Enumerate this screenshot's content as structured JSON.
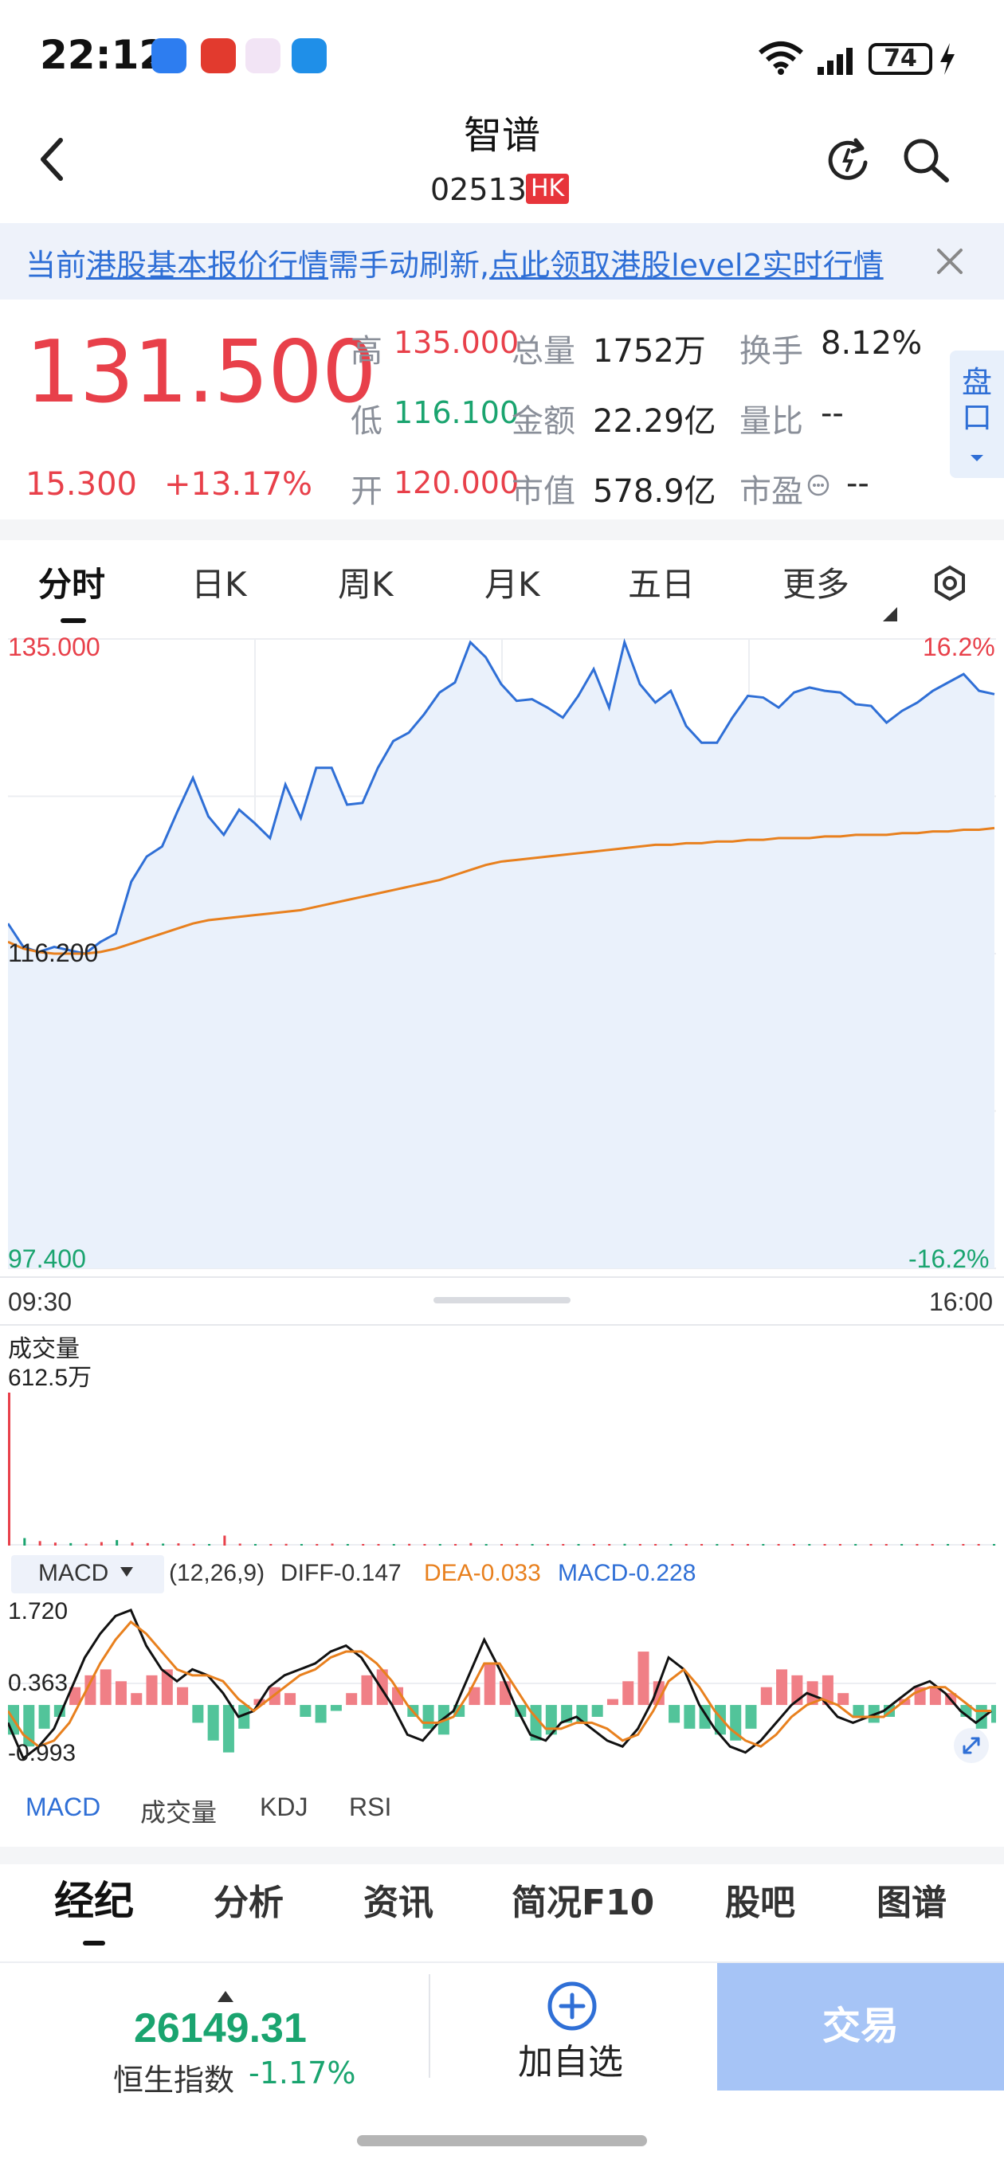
{
  "status_bar": {
    "time": "22:12",
    "battery": "74"
  },
  "header": {
    "title": "智谱",
    "code": "02513",
    "market_badge": "HK"
  },
  "banner": {
    "text_a": "当前港股基本报价行情需手动刷新,",
    "text_link": "点此领取港股level2实时行情",
    "text_a_prefix": "当前",
    "text_a_u": "港股基本报价行情",
    "text_a_suffix": "需手动刷新,"
  },
  "quote": {
    "price": "131.500",
    "change": "15.300",
    "change_pct": "+13.17%",
    "rows": [
      {
        "l1": "高",
        "v1": "135.000",
        "l2": "总量",
        "v2": "1752万",
        "l3": "换手",
        "v3": "8.12%"
      },
      {
        "l1": "低",
        "v1": "116.100",
        "l2": "金额",
        "v2": "22.29亿",
        "l3": "量比",
        "v3": "--"
      },
      {
        "l1": "开",
        "v1": "120.000",
        "l2": "市值",
        "v2": "578.9亿",
        "l3": "市盈",
        "v3": "--"
      }
    ],
    "pankou_label": "盘口"
  },
  "period_tabs": [
    "分时",
    "日K",
    "周K",
    "月K",
    "五日",
    "更多"
  ],
  "chart_data": [
    {
      "type": "line",
      "title": "",
      "ylim": [
        97.4,
        135.0
      ],
      "y_labels": {
        "top": "135.000",
        "mid": "116.200",
        "bottom": "97.400",
        "pct_top": "16.2%",
        "pct_bottom": "-16.2%"
      },
      "x_labels": {
        "start": "09:30",
        "end": "16:00"
      },
      "series": [
        {
          "color": "#2f6fd6",
          "values": [
            118.0,
            116.6,
            116.3,
            116.6,
            116.4,
            116.2,
            116.9,
            117.4,
            120.5,
            122.0,
            122.6,
            124.7,
            126.7,
            124.4,
            123.3,
            124.8,
            124.0,
            123.1,
            126.3,
            124.3,
            127.3,
            127.3,
            125.1,
            125.2,
            127.3,
            128.9,
            129.4,
            130.5,
            131.8,
            132.4,
            134.8,
            133.9,
            132.3,
            131.3,
            131.4,
            130.9,
            130.3,
            131.6,
            133.2,
            130.9,
            134.8,
            132.3,
            131.2,
            131.9,
            129.8,
            128.8,
            128.8,
            130.3,
            131.6,
            131.5,
            130.9,
            131.8,
            132.1,
            131.9,
            131.8,
            131.1,
            131.0,
            130.0,
            130.7,
            131.2,
            131.9,
            132.4,
            132.9,
            131.9,
            131.7
          ]
        },
        {
          "color": "#e8801e",
          "values": [
            116.9,
            116.5,
            116.3,
            116.2,
            116.2,
            116.2,
            116.3,
            116.5,
            116.8,
            117.1,
            117.4,
            117.7,
            118.0,
            118.2,
            118.3,
            118.4,
            118.5,
            118.6,
            118.7,
            118.8,
            119.0,
            119.2,
            119.4,
            119.6,
            119.8,
            120.0,
            120.2,
            120.4,
            120.6,
            120.9,
            121.2,
            121.5,
            121.7,
            121.8,
            121.9,
            122.0,
            122.1,
            122.2,
            122.3,
            122.4,
            122.5,
            122.6,
            122.7,
            122.7,
            122.8,
            122.8,
            122.9,
            122.9,
            123.0,
            123.0,
            123.1,
            123.1,
            123.1,
            123.2,
            123.2,
            123.3,
            123.3,
            123.3,
            123.4,
            123.4,
            123.5,
            123.5,
            123.6,
            123.6,
            123.7
          ]
        }
      ]
    },
    {
      "type": "bar",
      "title": "成交量",
      "max_label": "612.5万",
      "ylim": [
        0,
        612.5
      ],
      "values": [
        612.5,
        30,
        18,
        12,
        10,
        8,
        14,
        22,
        12,
        10,
        8,
        9,
        7,
        6,
        40,
        8,
        6,
        5,
        7,
        6,
        5,
        8,
        6,
        5,
        4,
        6,
        7,
        5,
        4,
        6,
        10,
        5,
        4,
        5,
        6,
        4,
        5,
        4,
        6,
        5,
        7,
        4,
        5,
        4,
        3,
        5,
        4,
        3,
        5,
        4,
        6,
        3,
        4,
        5,
        3,
        4,
        3,
        5,
        4,
        3,
        4,
        3,
        4,
        5,
        3
      ]
    },
    {
      "type": "bar",
      "title": "MACD",
      "params": "(12,26,9)",
      "diff_label": "DIFF-0.147",
      "dea_label": "DEA-0.033",
      "macd_label": "MACD-0.228",
      "y_labels": {
        "top": "1.720",
        "mid": "0.363",
        "bottom": "-0.993"
      },
      "ylim": [
        -0.993,
        1.72
      ],
      "macd": [
        -0.5,
        -0.7,
        -0.4,
        -0.2,
        0.3,
        0.5,
        0.6,
        0.4,
        0.2,
        0.5,
        0.6,
        0.3,
        -0.3,
        -0.6,
        -0.8,
        -0.4,
        0.1,
        0.3,
        0.2,
        -0.2,
        -0.3,
        -0.1,
        0.2,
        0.5,
        0.6,
        0.3,
        -0.2,
        -0.4,
        -0.5,
        -0.2,
        0.3,
        0.7,
        0.4,
        -0.2,
        -0.6,
        -0.5,
        -0.3,
        -0.3,
        -0.2,
        0.1,
        0.4,
        0.9,
        0.4,
        -0.3,
        -0.4,
        -0.4,
        -0.5,
        -0.6,
        -0.4,
        0.3,
        0.6,
        0.5,
        0.4,
        0.5,
        0.2,
        -0.2,
        -0.3,
        -0.2,
        0.1,
        0.3,
        0.3,
        0.2,
        -0.2,
        -0.4,
        -0.3
      ],
      "diff": [
        -0.3,
        -0.9,
        -0.7,
        -0.4,
        0.2,
        0.8,
        1.2,
        1.5,
        1.6,
        1.0,
        0.6,
        0.4,
        0.6,
        0.5,
        0.2,
        -0.2,
        -0.1,
        0.3,
        0.5,
        0.6,
        0.7,
        0.9,
        1.0,
        0.8,
        0.4,
        0.0,
        -0.5,
        -0.6,
        -0.3,
        -0.1,
        0.5,
        1.1,
        0.6,
        0.0,
        -0.5,
        -0.6,
        -0.3,
        -0.2,
        -0.4,
        -0.6,
        -0.7,
        -0.4,
        0.1,
        0.8,
        0.6,
        0.0,
        -0.4,
        -0.7,
        -0.8,
        -0.6,
        -0.3,
        0.0,
        0.2,
        0.1,
        -0.2,
        -0.3,
        -0.2,
        -0.1,
        0.1,
        0.3,
        0.4,
        0.2,
        -0.1,
        -0.3,
        -0.1
      ],
      "dea": [
        -0.1,
        -0.5,
        -0.7,
        -0.6,
        -0.3,
        0.2,
        0.7,
        1.1,
        1.4,
        1.2,
        0.9,
        0.6,
        0.5,
        0.5,
        0.4,
        0.1,
        -0.1,
        0.1,
        0.3,
        0.5,
        0.6,
        0.8,
        0.9,
        0.9,
        0.7,
        0.4,
        0.0,
        -0.3,
        -0.3,
        -0.2,
        0.2,
        0.7,
        0.7,
        0.3,
        -0.1,
        -0.4,
        -0.4,
        -0.3,
        -0.3,
        -0.4,
        -0.6,
        -0.5,
        -0.1,
        0.4,
        0.6,
        0.3,
        -0.1,
        -0.4,
        -0.6,
        -0.7,
        -0.5,
        -0.2,
        0.0,
        0.1,
        0.0,
        -0.2,
        -0.2,
        -0.2,
        0.0,
        0.2,
        0.3,
        0.3,
        0.1,
        -0.1,
        -0.1
      ]
    }
  ],
  "indicator_tabs": [
    "MACD",
    "成交量",
    "KDJ",
    "RSI"
  ],
  "bottom_tabs": [
    "经纪",
    "分析",
    "资讯",
    "简况F10",
    "股吧",
    "图谱"
  ],
  "bottom_bar": {
    "index_value": "26149.31",
    "index_name": "恒生指数",
    "index_change": "-1.17%",
    "fav_label": "加自选",
    "trade_label": "交易"
  },
  "colors": {
    "up": "#e8404a",
    "down": "#1aa46f",
    "accent": "#2f6fd6",
    "avg_line": "#e8801e"
  }
}
